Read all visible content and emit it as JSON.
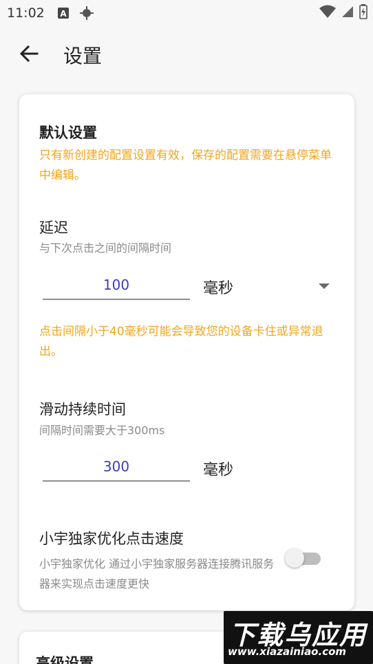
{
  "status_bar": {
    "time": "11:02",
    "icons": [
      "a-icon",
      "gps-icon",
      "wifi-icon",
      "signal-icon",
      "battery-icon"
    ]
  },
  "app_bar": {
    "title": "设置",
    "back_icon": "arrow-left-icon"
  },
  "default_settings": {
    "title": "默认设置",
    "notice": "只有新创建的配置设置有效，保存的配置需要在悬停菜单中编辑。",
    "delay": {
      "title": "延迟",
      "subtitle": "与下次点击之间的间隔时间",
      "value": "100",
      "unit": "毫秒",
      "warning": "点击间隔小于40毫秒可能会导致您的设备卡住或异常退出。"
    },
    "swipe_duration": {
      "title": "滑动持续时间",
      "subtitle": "间隔时间需要大于300ms",
      "value": "300",
      "unit": "毫秒"
    },
    "optimize": {
      "title": "小宇独家优化点击速度",
      "subtitle": "小宇独家优化 通过小宇独家服务器连接腾讯服务器来实现点击速度更快",
      "enabled": false
    }
  },
  "advanced_settings": {
    "title": "高级设置"
  },
  "watermark": {
    "title": "下载乌应用",
    "url": "www.xiazainiao.com"
  },
  "colors": {
    "warning": "#f3a51a",
    "input_value": "#3c3cc0"
  }
}
